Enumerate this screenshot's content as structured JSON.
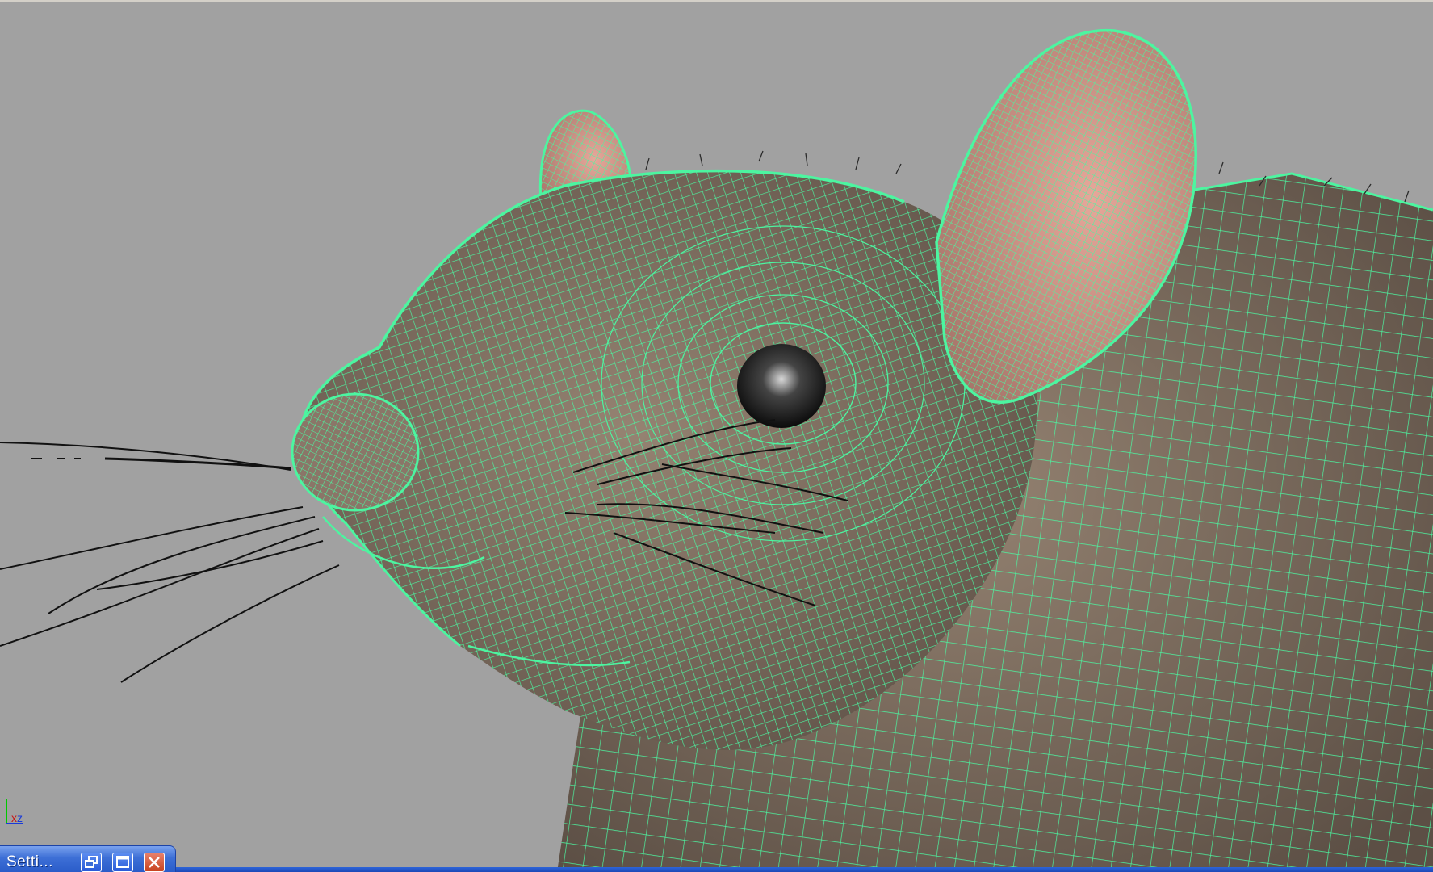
{
  "viewport": {
    "background_color": "#a1a1a1",
    "wireframe_color": "#4cf5a0",
    "mesh_fur_color": "#7e6d60",
    "ear_inner_color": "#d99a8e",
    "eye_color": "#151515",
    "axis_gizmo": {
      "x_label": "x",
      "z_label": "z",
      "y_color": "#00c800",
      "z_color": "#1a3ad8",
      "x_color": "#c81414"
    }
  },
  "minimized_window": {
    "title": "Setti...",
    "restore_icon": "restore-icon",
    "maximize_icon": "maximize-icon",
    "close_icon": "close-icon"
  }
}
